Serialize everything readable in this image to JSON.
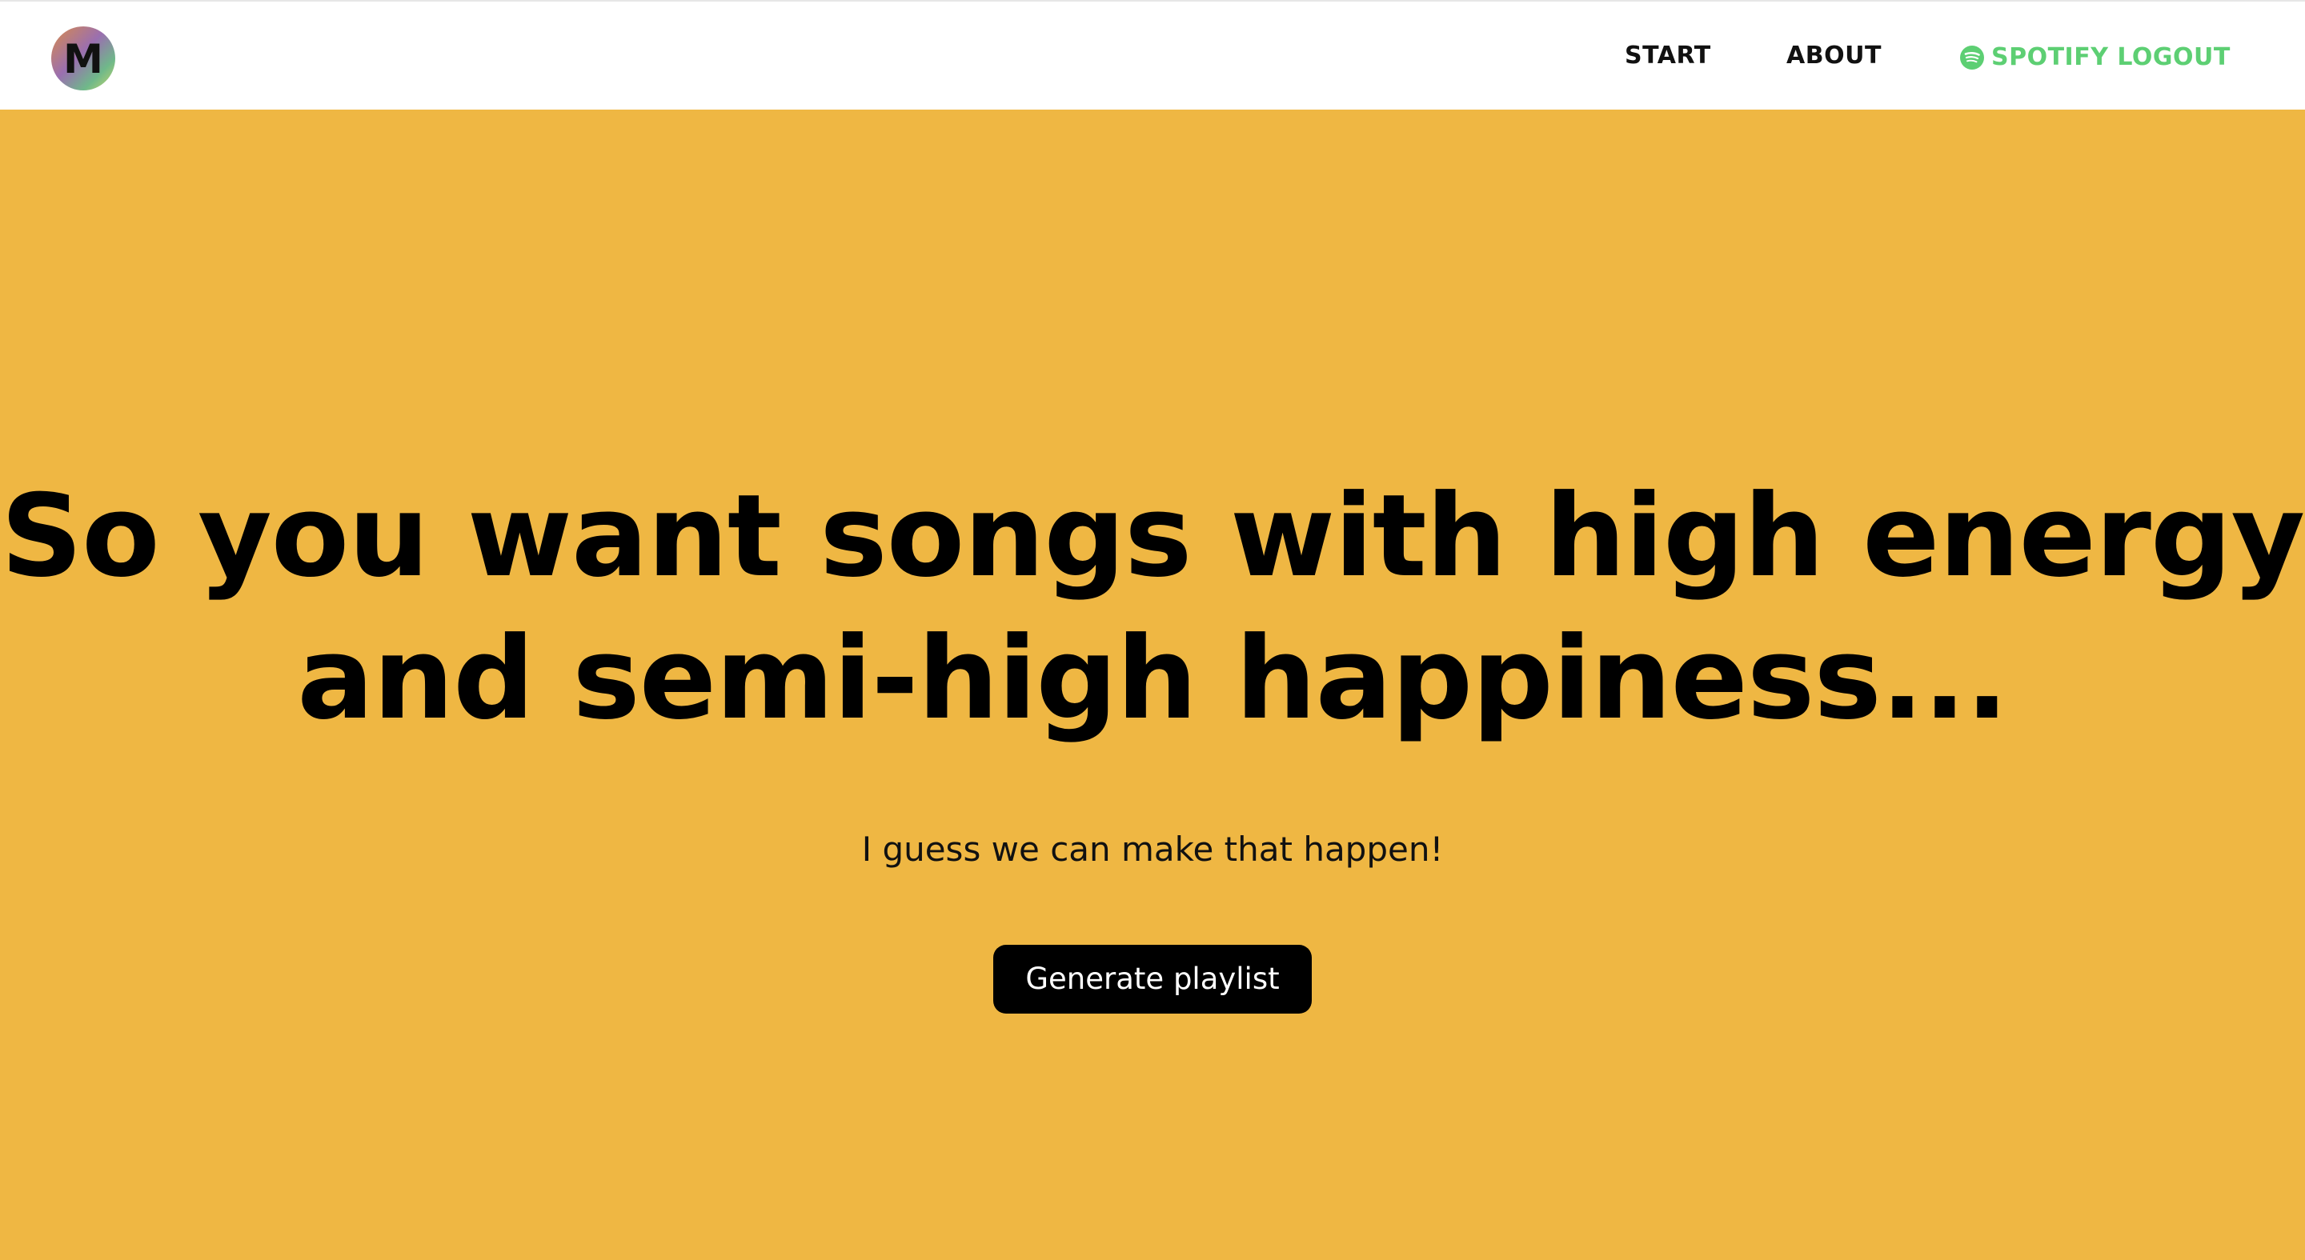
{
  "nav": {
    "logo_letter": "M",
    "start_label": "START",
    "about_label": "ABOUT",
    "logout_label": "SPOTIFY LOGOUT"
  },
  "hero": {
    "title": "So you want songs with high energy and semi-high happiness...",
    "subtitle": "I guess we can make that happen!",
    "button_label": "Generate playlist"
  },
  "colors": {
    "background": "#EFB743",
    "navbar": "#FFFFFF",
    "spotify_green": "#5DCF73",
    "button": "#000000",
    "text": "#000000"
  },
  "icons": {
    "logo": "m-logo-gradient-circle",
    "logout": "spotify-icon"
  }
}
